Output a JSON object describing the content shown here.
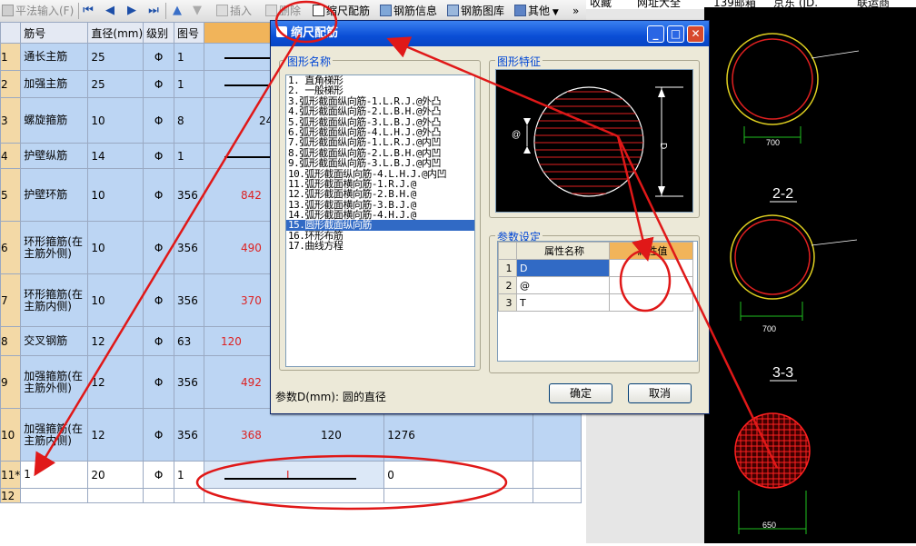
{
  "toolbar": {
    "plan_input": "平法输入(F)",
    "insert": "插入",
    "delete": "删除",
    "scale_rebar": "缩尺配筋",
    "rebar_info": "钢筋信息",
    "rebar_library": "钢筋图库",
    "other": "其他",
    "more": "»"
  },
  "browserbar": {
    "items": [
      "收藏",
      "网址大全",
      "139邮箱",
      "京东 (JD.",
      "联运商"
    ]
  },
  "grid": {
    "headers": [
      "筋号",
      "直径(mm)",
      "级别",
      "图号"
    ],
    "rows": [
      {
        "num": "1",
        "name": "通长主筋",
        "dia": "25",
        "grade": "Φ",
        "fig": "1",
        "dim": "",
        "extra": ""
      },
      {
        "num": "2",
        "name": "加强主筋",
        "dia": "25",
        "grade": "Φ",
        "fig": "1",
        "dim": "",
        "extra": ""
      },
      {
        "num": "3",
        "name": "螺旋箍筋",
        "dia": "10",
        "grade": "Φ",
        "fig": "8",
        "dim": "249",
        "extra": ""
      },
      {
        "num": "4",
        "name": "护壁纵筋",
        "dia": "14",
        "grade": "Φ",
        "fig": "1",
        "dim": "",
        "extra": ""
      },
      {
        "num": "5",
        "name": "护壁环筋",
        "dia": "10",
        "grade": "Φ",
        "fig": "356",
        "dim": "842",
        "extra": ""
      },
      {
        "num": "6",
        "name": "环形箍筋(在主筋外侧)",
        "dia": "10",
        "grade": "Φ",
        "fig": "356",
        "dim": "490",
        "extra": ""
      },
      {
        "num": "7",
        "name": "环形箍筋(在主筋内侧)",
        "dia": "10",
        "grade": "Φ",
        "fig": "356",
        "dim": "370",
        "extra": ""
      },
      {
        "num": "8",
        "name": "交叉钢筋",
        "dia": "12",
        "grade": "Φ",
        "fig": "63",
        "dim": "120",
        "extra": ""
      },
      {
        "num": "9",
        "name": "加强箍筋(在主筋外侧)",
        "dia": "12",
        "grade": "Φ",
        "fig": "356",
        "dim": "492",
        "extra": ""
      },
      {
        "num": "10",
        "name": "加强箍筋(在主筋内侧)",
        "dia": "12",
        "grade": "Φ",
        "fig": "356",
        "dim": "368",
        "extra": "120",
        "len": "1276"
      },
      {
        "num": "11*",
        "name": "1",
        "dia": "20",
        "grade": "Φ",
        "fig": "1",
        "dim": "L",
        "extra": "",
        "len": "0"
      },
      {
        "num": "12",
        "name": "",
        "dia": "",
        "grade": "",
        "fig": "",
        "dim": "",
        "extra": ""
      }
    ]
  },
  "dialog": {
    "title": "缩尺配筋",
    "shape_group": "图形名称",
    "feature_group": "图形特征",
    "param_group": "参数设定",
    "shapes": [
      "1. 直角梯形",
      "2. 一般梯形",
      "3.弧形截面纵向筋-1.L.R.J.@外凸",
      "4.弧形截面纵向筋-2.L.B.H.@外凸",
      "5.弧形截面纵向筋-3.L.B.J.@外凸",
      "6.弧形截面纵向筋-4.L.H.J.@外凸",
      "7.弧形截面纵向筋-1.L.R.J.@内凹",
      "8.弧形截面纵向筋-2.L.B.H.@内凹",
      "9.弧形截面纵向筋-3.L.B.J.@内凹",
      "10.弧形截面纵向筋-4.L.H.J.@内凹",
      "11.弧形截面横向筋-1.R.J.@",
      "12.弧形截面横向筋-2.B.H.@",
      "13.弧形截面横向筋-3.B.J.@",
      "14.弧形截面横向筋-4.H.J.@",
      "15.圆形截面纵向筋",
      "16.环形布筋",
      "17.曲线方程"
    ],
    "selected_index": 14,
    "param_headers": [
      "属性名称",
      "属性值"
    ],
    "params": [
      {
        "n": "1",
        "name": "D",
        "value": ""
      },
      {
        "n": "2",
        "name": "@",
        "value": ""
      },
      {
        "n": "3",
        "name": "T",
        "value": ""
      }
    ],
    "hint": "参数D(mm): 圆的直径",
    "ok": "确定",
    "cancel": "取消",
    "preview_labels": {
      "at": "@",
      "d": "D"
    }
  },
  "cad": {
    "label_700a": "700",
    "label_22": "2-2",
    "label_700b": "700",
    "label_33": "3-3",
    "label_650": "650"
  },
  "colors": {
    "annotation": "#e01818",
    "row_blue": "#bcd5f3",
    "row_num": "#f3d9a6"
  }
}
